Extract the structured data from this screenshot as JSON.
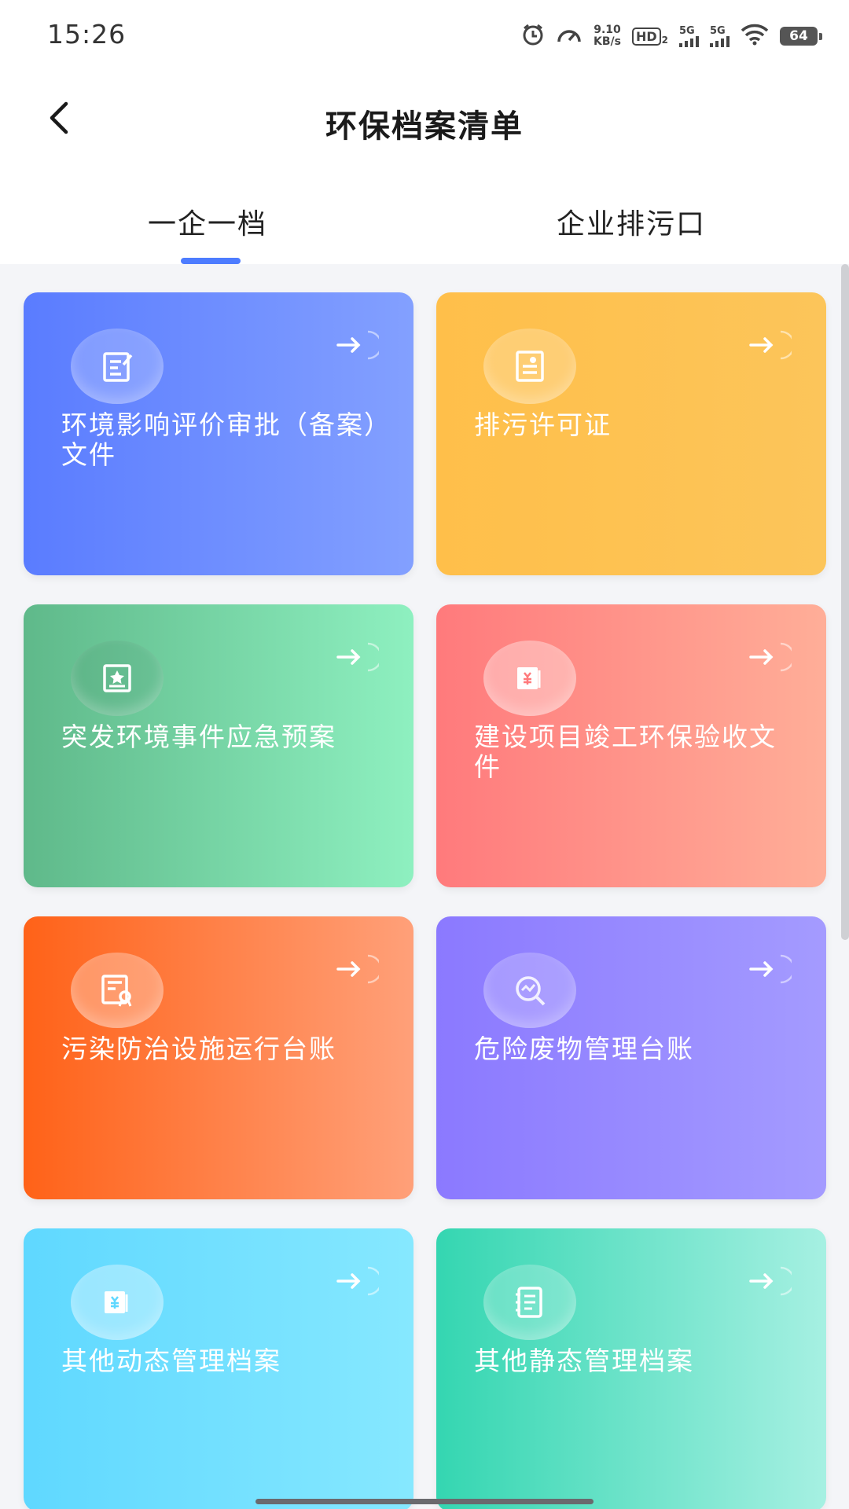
{
  "status_bar": {
    "time": "15:26",
    "net_speed_value": "9.10",
    "net_speed_unit": "KB/s",
    "hd_label": "HD",
    "hd_sub": "2",
    "sim1_label": "5G",
    "sim2_label": "5G",
    "battery": "64",
    "icons": [
      "alarm-icon",
      "speedometer-icon",
      "hd-icon",
      "signal-icon",
      "signal-icon",
      "wifi-icon",
      "battery-icon"
    ]
  },
  "header": {
    "title": "环保档案清单",
    "back_icon": "chevron-left-icon"
  },
  "tabs": [
    {
      "label": "一企一档",
      "active": true
    },
    {
      "label": "企业排污口",
      "active": false
    }
  ],
  "cards": [
    {
      "label": "环境影响评价审批（备案）文件",
      "icon": "document-edit-icon",
      "gradient": [
        "#5a7cff",
        "#83a0ff"
      ]
    },
    {
      "label": "排污许可证",
      "icon": "id-card-icon",
      "gradient": [
        "#ffbf4a",
        "#fcc55a"
      ]
    },
    {
      "label": "突发环境事件应急预案",
      "icon": "star-document-icon",
      "gradient": [
        "#5fb98a",
        "#8ef0c0"
      ]
    },
    {
      "label": "建设项目竣工环保验收文件",
      "icon": "money-book-icon",
      "gradient": [
        "#ff7a7c",
        "#ffae98"
      ]
    },
    {
      "label": "污染防治设施运行台账",
      "icon": "certificate-icon",
      "gradient": [
        "#ff6218",
        "#ffa079"
      ]
    },
    {
      "label": "危险废物管理台账",
      "icon": "chart-search-icon",
      "gradient": [
        "#8b79ff",
        "#a49bff"
      ]
    },
    {
      "label": "其他动态管理档案",
      "icon": "money-book-icon",
      "gradient": [
        "#5fd8ff",
        "#86e8ff"
      ]
    },
    {
      "label": "其他静态管理档案",
      "icon": "list-document-icon",
      "gradient": [
        "#34d6b1",
        "#a6f0e2"
      ]
    }
  ],
  "card_arrow_icon": "arrow-right-icon"
}
